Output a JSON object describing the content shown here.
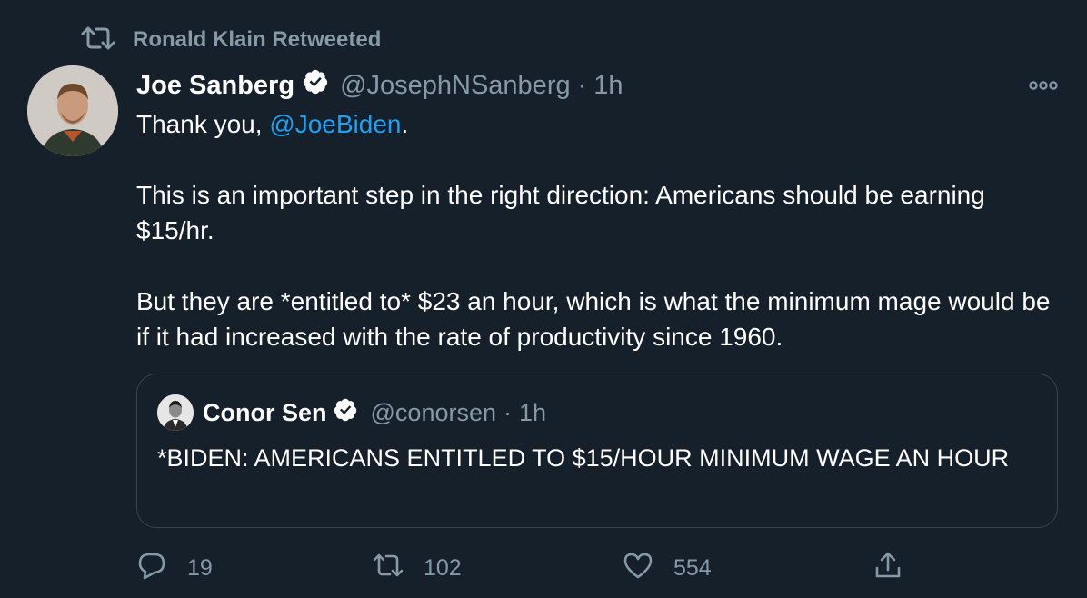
{
  "retweet_banner": {
    "icon": "retweet-icon",
    "label": "Ronald Klain Retweeted"
  },
  "tweet": {
    "author_name": "Joe Sanberg",
    "verified_icon": "verified-badge-icon",
    "handle": "@JosephNSanberg",
    "separator": "·",
    "timestamp": "1h",
    "more_icon": "more-options-icon",
    "text": {
      "line1_prefix": "Thank you, ",
      "mention": "@JoeBiden",
      "line1_suffix": ".",
      "paragraph2": "This is an important step in the right direction: Americans should be earning $15/hr.",
      "paragraph3": "But they are *entitled to* $23 an hour, which is what the minimum mage would be if it had increased with the rate of productivity since 1960."
    }
  },
  "quoted_tweet": {
    "author_name": "Conor Sen",
    "handle": "@conorsen",
    "separator": "·",
    "timestamp": "1h",
    "text": "*BIDEN: AMERICANS ENTITLED TO $15/HOUR MINIMUM WAGE AN HOUR"
  },
  "actions": {
    "reply": {
      "icon": "reply-icon",
      "count": "19"
    },
    "retweet": {
      "icon": "retweet-icon",
      "count": "102"
    },
    "like": {
      "icon": "heart-icon",
      "count": "554"
    },
    "share": {
      "icon": "share-icon"
    }
  },
  "colors": {
    "background": "#15202b",
    "muted": "#8899a6",
    "link": "#1da1f2",
    "border": "#38444d"
  }
}
